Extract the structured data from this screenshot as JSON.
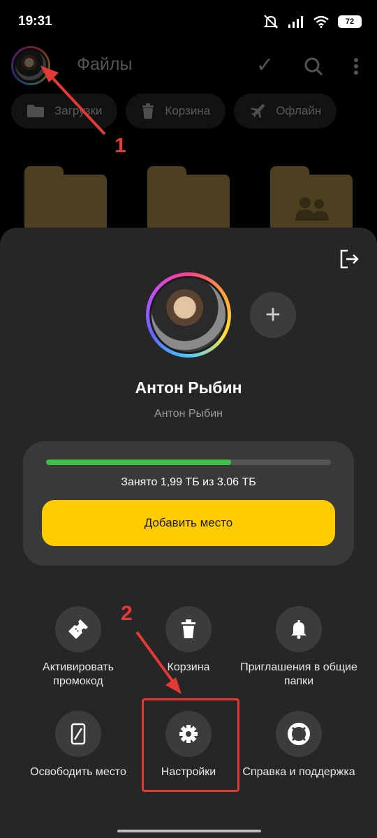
{
  "status_bar": {
    "time": "19:31",
    "battery": "72"
  },
  "background_app": {
    "title": "Файлы",
    "chips": [
      {
        "label": "Загрузки",
        "icon": "folder-icon"
      },
      {
        "label": "Корзина",
        "icon": "trash-icon"
      },
      {
        "label": "Офлайн",
        "icon": "airplane-icon"
      }
    ]
  },
  "annotations": {
    "step1": "1",
    "step2": "2",
    "color": "#e53935"
  },
  "profile": {
    "name": "Антон Рыбин",
    "subtitle": "Антон Рыбин",
    "add_account_symbol": "+"
  },
  "storage": {
    "used_fraction": 0.65,
    "text": "Занято 1,99 ТБ из 3.06 ТБ",
    "add_button_label": "Добавить место",
    "bar_color": "#3fbf4a",
    "button_color": "#ffcc00"
  },
  "actions": [
    {
      "label": "Активировать промокод",
      "icon": "ticket-icon"
    },
    {
      "label": "Корзина",
      "icon": "trash-icon"
    },
    {
      "label": "Приглашения в общие папки",
      "icon": "bell-icon"
    },
    {
      "label": "Освободить место",
      "icon": "phone-slash-icon"
    },
    {
      "label": "Настройки",
      "icon": "gear-icon"
    },
    {
      "label": "Справка и поддержка",
      "icon": "lifebuoy-icon"
    }
  ]
}
